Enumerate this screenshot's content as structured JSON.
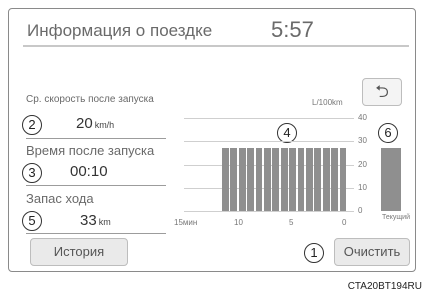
{
  "header": {
    "title": "Информация о поездке",
    "time": "5:57"
  },
  "back_icon": "u-turn-back-arrow",
  "fields": {
    "avg_speed": {
      "label": "Ср. скорость после запуска",
      "value": "20",
      "unit": "km/h",
      "callout": "2"
    },
    "time_since_start": {
      "label": "Время после запуска",
      "value": "00:10",
      "callout": "3"
    },
    "range": {
      "label": "Запас хода",
      "value": "33",
      "unit": "km",
      "callout": "5"
    }
  },
  "buttons": {
    "history": "История",
    "clear": "Очистить",
    "clear_callout": "1"
  },
  "chart_callouts": {
    "history_graph": "4",
    "current_bar": "6"
  },
  "chart_data": {
    "type": "bar",
    "unit_label": "L/100km",
    "ylim": [
      0,
      40
    ],
    "y_ticks": [
      "40",
      "30",
      "20",
      "10",
      "0"
    ],
    "x_ticks": [
      "15мин",
      "10",
      "5",
      "0"
    ],
    "history_values": [
      27,
      27,
      27,
      27,
      27,
      27,
      27,
      27,
      27,
      27,
      27,
      27,
      27,
      27,
      27
    ],
    "current_label": "Текущий",
    "current_value": 27
  },
  "image_code": "CTA20BT194RU",
  "colors": {
    "bar": "#8f8f8f",
    "text": "#6a6a6a",
    "button_bg": "#eaeaea"
  }
}
